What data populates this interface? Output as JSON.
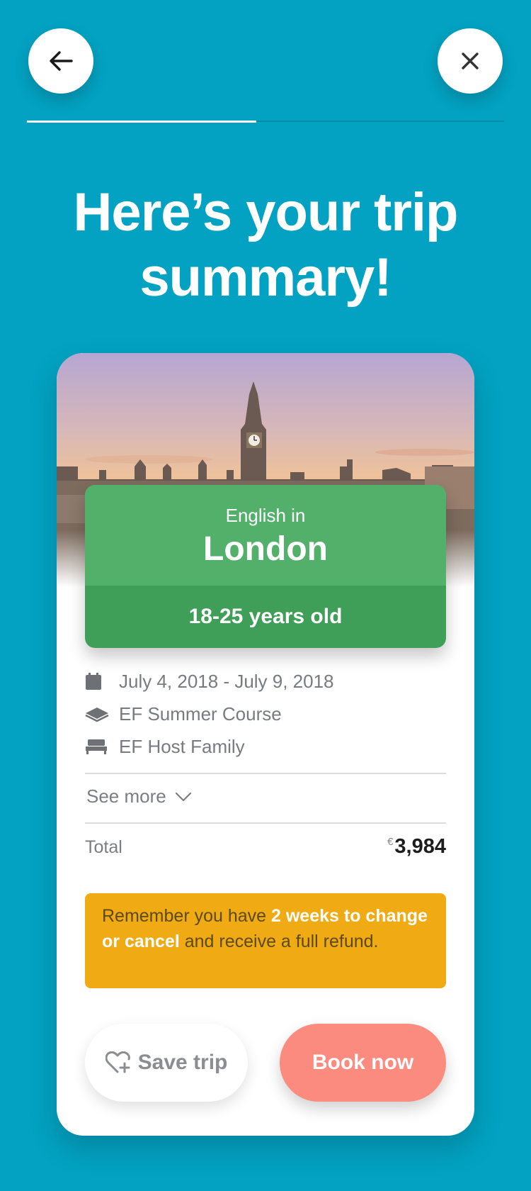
{
  "header": {
    "back_icon": "arrow-left-icon",
    "close_icon": "close-icon",
    "progress": 0.48
  },
  "title": {
    "line1": "Here’s your trip",
    "line2": "summary!"
  },
  "trip": {
    "hero_image": "London skyline with Big Ben at sunset",
    "prefix": "English in",
    "city": "London",
    "age_group": "18-25 years old",
    "details": [
      {
        "icon": "calendar-icon",
        "text": "July 4, 2018 - July 9, 2018"
      },
      {
        "icon": "book-icon",
        "text": "EF Summer Course"
      },
      {
        "icon": "bed-icon",
        "text": "EF Host Family"
      }
    ],
    "see_more": "See more",
    "total_label": "Total",
    "currency": "€",
    "total_value": "3,984"
  },
  "notice": {
    "text_before": "Remember you have ",
    "bold": "2 weeks to change or cancel",
    "text_after": " and receive a full refund."
  },
  "actions": {
    "save_label": "Save trip",
    "book_label": "Book now"
  },
  "colors": {
    "background": "#03a2c2",
    "dest_green": "#52b06a",
    "dest_green_dark": "#3f9e57",
    "notice_yellow": "#f0aa14",
    "book_coral": "#fc8b7f"
  }
}
